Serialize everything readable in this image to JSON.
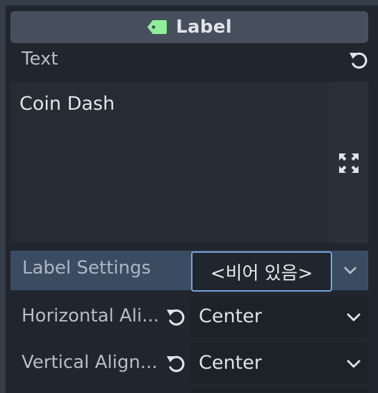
{
  "inspector": {
    "class_name": "Label",
    "class_icon": "label-tag-icon",
    "accent_color": "#8eef97",
    "text_property": {
      "label": "Text",
      "value": "Coin Dash",
      "revert_icon": "revert-icon",
      "expand_icon": "expand-icon"
    },
    "label_settings": {
      "label": "Label Settings",
      "value": "<비어 있음>",
      "dropdown_icon": "chevron-down-icon"
    },
    "horizontal_alignment": {
      "label": "Horizontal Ali...",
      "value": "Center",
      "revert_icon": "revert-icon",
      "dropdown_icon": "chevron-down-icon"
    },
    "vertical_alignment": {
      "label": "Vertical Align...",
      "value": "Center",
      "revert_icon": "revert-icon",
      "dropdown_icon": "chevron-down-icon"
    }
  }
}
